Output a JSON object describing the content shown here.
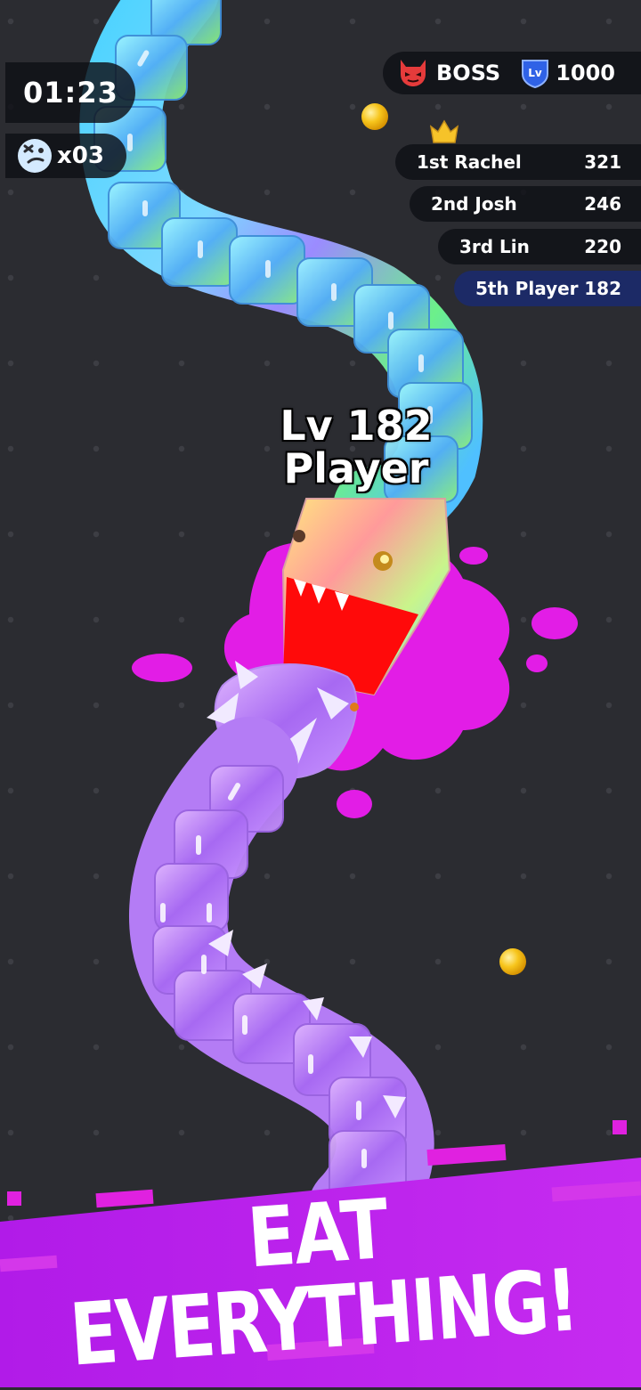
{
  "hud": {
    "timer": "01:23",
    "kills": "x03",
    "boss_label": "BOSS",
    "boss_level_badge": "Lv",
    "boss_level": "1000"
  },
  "leaderboard": [
    {
      "rank_name": "1st Rachel",
      "score": "321",
      "is_player": false
    },
    {
      "rank_name": "2nd Josh",
      "score": "246",
      "is_player": false
    },
    {
      "rank_name": "3rd Lin",
      "score": "220",
      "is_player": false
    },
    {
      "rank_name": "5th Player",
      "score": "182",
      "is_player": true
    }
  ],
  "player": {
    "level_text": "Lv 182",
    "name": "Player"
  },
  "banner": {
    "line1": "EAT",
    "line2": "EVERYTHING!"
  },
  "colors": {
    "background": "#2b2c31",
    "splat": "#e21de6",
    "banner": "#b020e8",
    "player_highlight": "#1c2a66",
    "coin": "#f5c518"
  },
  "icons": [
    "skull-icon",
    "devil-icon",
    "level-shield-icon",
    "crown-icon"
  ]
}
